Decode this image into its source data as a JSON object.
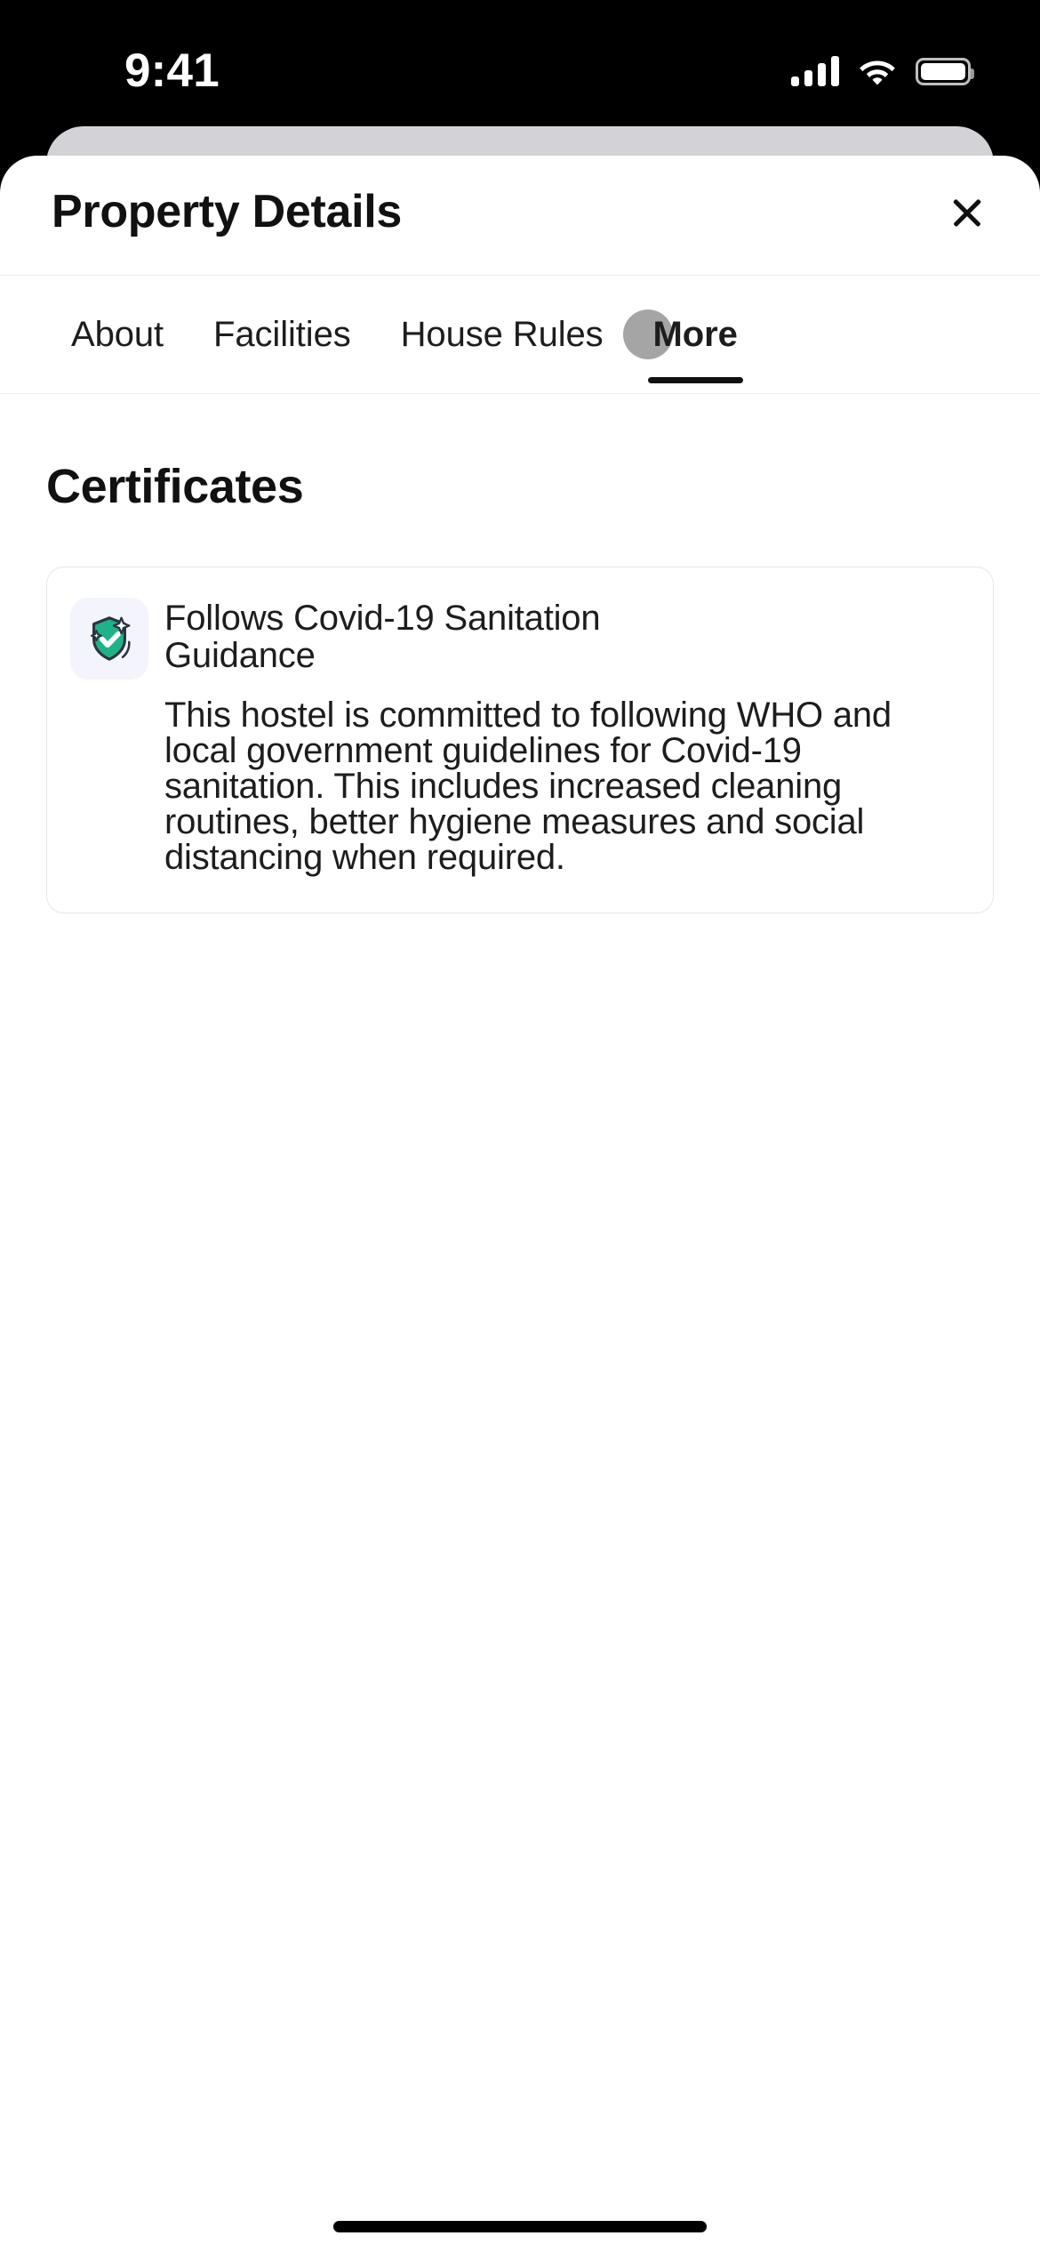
{
  "status_bar": {
    "time": "9:41",
    "cellular_icon": "cellular-signal-icon",
    "wifi_icon": "wifi-icon",
    "battery_icon": "battery-full-icon"
  },
  "header": {
    "title": "Property Details",
    "close_label": "Close",
    "close_icon": "close-x-icon"
  },
  "tabs": {
    "items": [
      {
        "label": "About",
        "active": false
      },
      {
        "label": "Facilities",
        "active": false
      },
      {
        "label": "House Rules",
        "active": false
      },
      {
        "label": "More",
        "active": true
      }
    ],
    "active_index": 3
  },
  "main": {
    "section_title": "Certificates",
    "certificates": [
      {
        "icon": "shield-check-sparkle-icon",
        "icon_color": "#1FB187",
        "icon_outline_color": "#2B3440",
        "icon_background": "#F4F4FC",
        "title": "Follows Covid-19 Sanitation Guidance",
        "description": "This hostel is committed to following WHO and local government guidelines for Covid-19 sanitation. This includes increased cleaning routines, better hygiene measures and social distancing when required."
      }
    ]
  },
  "touch_indicator": {
    "name": "tap-indicator",
    "color": "#828282",
    "target_tab": "More"
  },
  "home_indicator": {
    "name": "home-indicator"
  },
  "colors": {
    "sheet_background": "#FFFFFF",
    "stacked_sheet_background": "#D2D2D7",
    "screen_background": "#000000",
    "text_primary": "#1D1D1F",
    "divider": "#ECECEC",
    "card_border": "#E6E6E8"
  }
}
